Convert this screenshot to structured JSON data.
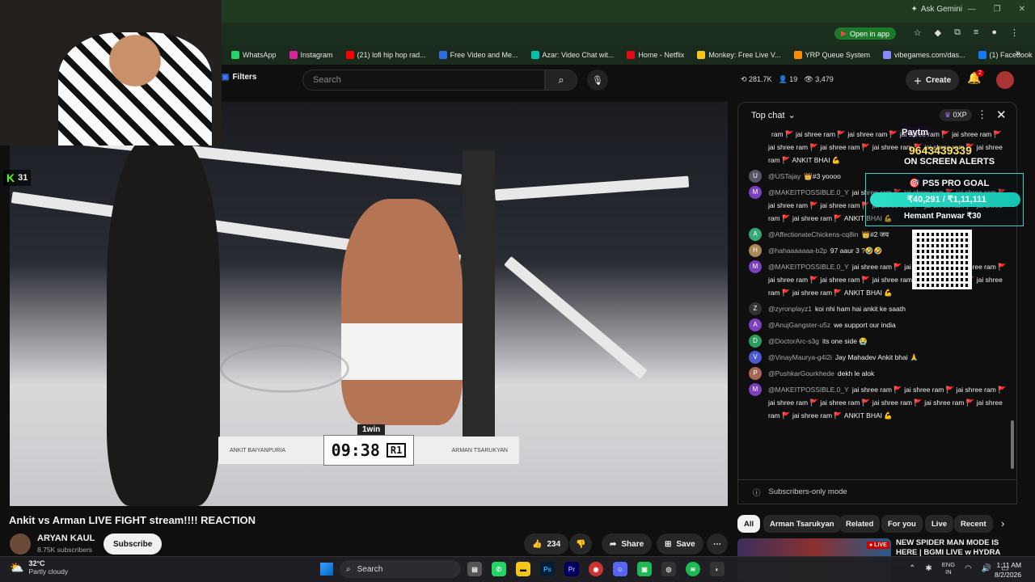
{
  "browser": {
    "gemini_label": "Ask Gemini",
    "open_in_app": "Open in app",
    "bookmarks": [
      {
        "label": "WhatsApp",
        "color": "#25d366"
      },
      {
        "label": "Instagram",
        "color": "#d6249f"
      },
      {
        "label": "(21) lofi hip hop rad...",
        "color": "#ff0000"
      },
      {
        "label": "Free Video and Me...",
        "color": "#2d6cdf"
      },
      {
        "label": "Azar: Video Chat wit...",
        "color": "#00c2a8"
      },
      {
        "label": "Home - Netflix",
        "color": "#e50914"
      },
      {
        "label": "Monkey: Free Live V...",
        "color": "#f5c518"
      },
      {
        "label": "YRP Queue System",
        "color": "#ff8c00"
      },
      {
        "label": "vibegames.com/das...",
        "color": "#8a8aff"
      },
      {
        "label": "(1) Facebook",
        "color": "#1877f2"
      }
    ]
  },
  "header": {
    "filters_label": "Filters",
    "search_placeholder": "Search",
    "stats": [
      "281.7K",
      "19",
      "3,479"
    ],
    "create_label": "Create",
    "notification_count": "2"
  },
  "video": {
    "scoreboard_left": "ANKIT BAIYANPURIA",
    "scoreboard_right": "ARMAN TSARUKYAN",
    "timer": "09:38",
    "round": "R1",
    "brand": "1win"
  },
  "webcam": {
    "kick_viewers": "31"
  },
  "chat": {
    "mode_label": "Top chat",
    "xp_label": "0XP",
    "footer_label": "Subscribers-only mode",
    "messages": [
      {
        "author": "",
        "text": "ram 🚩 jai shree ram 🚩 jai shree ram 🚩 jai shree ram 🚩 jai shree ram 🚩 jai shree ram 🚩 jai shree ram 🚩 jai shree ram 🚩 jai shree ram 🚩 jai shree ram 🚩 ANKIT BHAI 💪",
        "avatar_color": "transparent",
        "initial": ""
      },
      {
        "author": "@USTajay",
        "text": "👑#3 yoooo",
        "avatar_color": "#556",
        "initial": "U"
      },
      {
        "author": "@MAKEITPOSSIBLE.0_Y",
        "text": "jai shree ram 🚩 jai shree ram 🚩 jai shree ram 🚩 jai shree ram 🚩 jai shree ram 🚩 jai shree ram 🚩 jai shree ram 🚩 jai shree ram 🚩 jai shree ram 🚩 ANKIT BHAI 💪",
        "avatar_color": "#7b3fbf",
        "initial": "M"
      },
      {
        "author": "@AffectionateChickens-cq8in",
        "text": "👑#2 जय",
        "avatar_color": "#3a7",
        "initial": "A"
      },
      {
        "author": "@hahaaaaaaa-b2p",
        "text": "97 aaur 3 ?🤣🤣",
        "avatar_color": "#a85",
        "initial": "H"
      },
      {
        "author": "@MAKEITPOSSIBLE.0_Y",
        "text": "jai shree ram 🚩 jai shree ram 🚩 jai shree ram 🚩 jai shree ram 🚩 jai shree ram 🚩 jai shree ram 🚩 jai shree ram 🚩 jai shree ram 🚩 jai shree ram 🚩 ANKIT BHAI 💪",
        "avatar_color": "#7b3fbf",
        "initial": "M"
      },
      {
        "author": "@zyronplayz1",
        "text": "koi nhi ham hai ankit ke saath",
        "avatar_color": "#333",
        "initial": "Z"
      },
      {
        "author": "@AnujGangster-u5z",
        "text": "we support our india",
        "avatar_color": "#7b3fbf",
        "initial": "A"
      },
      {
        "author": "@DoctorArc-s3g",
        "text": "its one side 😭",
        "avatar_color": "#2a9d5a",
        "initial": "D"
      },
      {
        "author": "@VinayMaurya-g4i2i",
        "text": "Jay Mahadev Ankit bhai 🙏",
        "avatar_color": "#4a5bd0",
        "initial": "V"
      },
      {
        "author": "@PushkarGourkhede",
        "text": "dekh le alok",
        "avatar_color": "#a65",
        "initial": "P"
      },
      {
        "author": "@MAKEITPOSSIBLE.0_Y",
        "text": "jai shree ram 🚩 jai shree ram 🚩 jai shree ram 🚩 jai shree ram 🚩 jai shree ram 🚩 jai shree ram 🚩 jai shree ram 🚩 jai shree ram 🚩 jai shree ram 🚩 ANKIT BHAI 💪",
        "avatar_color": "#7b3fbf",
        "initial": "M"
      }
    ]
  },
  "overlay": {
    "upi_label": "Paytm",
    "phone": "9643439339",
    "alerts": "ON SCREEN ALERTS",
    "goal_title": "PS5 PRO GOAL",
    "goal_value": "₹40,291 / ₹1,11,111",
    "goal_donor": "Hemant Panwar ₹30"
  },
  "below": {
    "title": "Ankit vs Arman LIVE FIGHT stream!!!! REACTION",
    "channel": "ARYAN KAUL",
    "subs": "8.75K subscribers",
    "subscribe": "Subscribe",
    "likes": "234",
    "share": "Share",
    "save": "Save",
    "chips": [
      "All",
      "Arman Tsarukyan",
      "Related",
      "For you",
      "Live",
      "Recent"
    ],
    "rec_title": "NEW SPIDER MAN MODE IS HERE | BGMI LIVE w HYDRA ..."
  },
  "taskbar": {
    "temp": "32°C",
    "condition": "Partly cloudy",
    "search": "Search",
    "lang1": "ENG",
    "lang2": "IN",
    "time": "1:11 AM",
    "date": "8/2/2026"
  }
}
